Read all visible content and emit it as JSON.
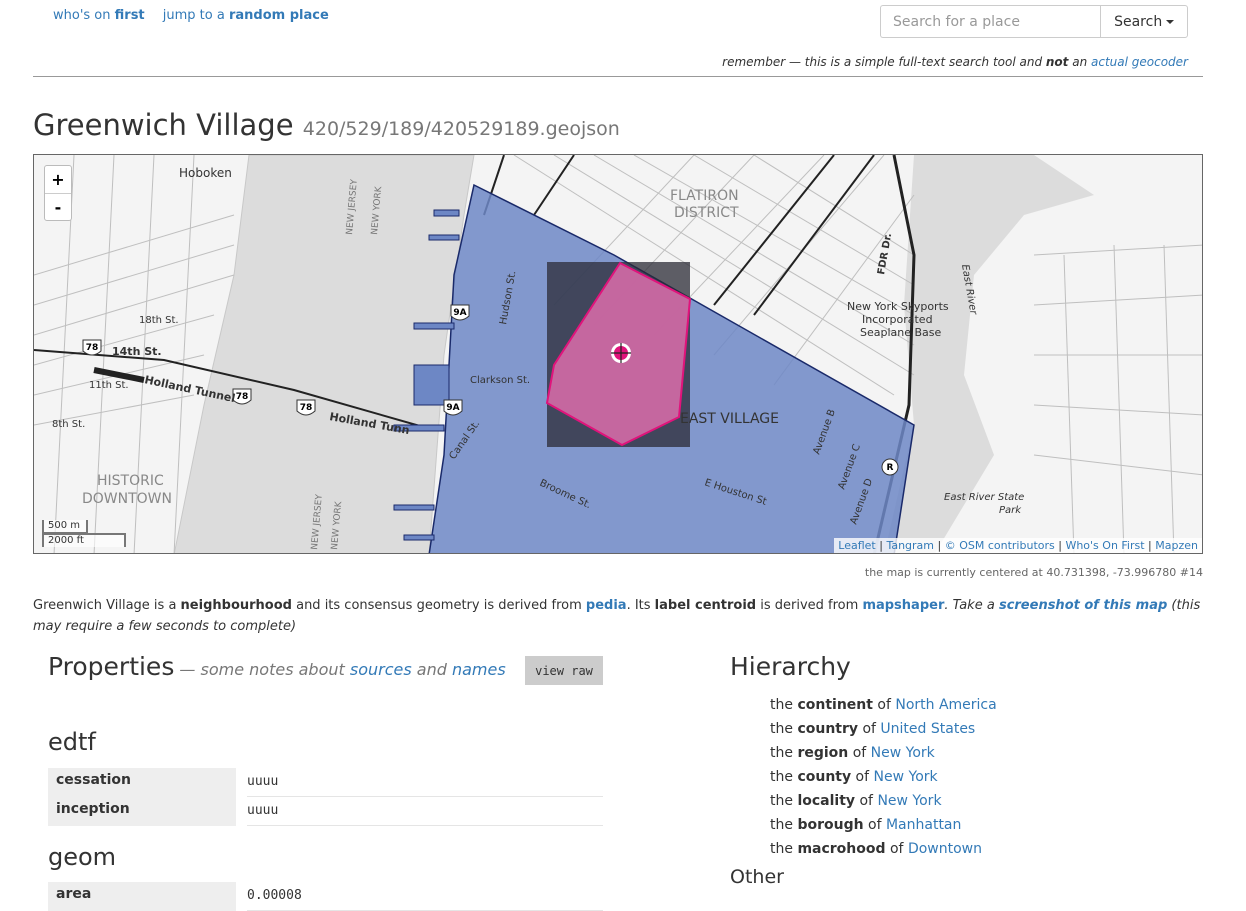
{
  "nav": {
    "whos_on_prefix": "who's on ",
    "whos_on_bold": "first",
    "jump_prefix": "jump to a ",
    "jump_bold": "random place"
  },
  "search": {
    "placeholder": "Search for a place",
    "button_label": "Search"
  },
  "remember": {
    "prefix": "remember — this is a simple full-text search tool and ",
    "not": "not",
    "middle": " an ",
    "link": "actual geocoder"
  },
  "place": {
    "name": "Greenwich Village",
    "path": "420/529/189/420529189.geojson"
  },
  "map": {
    "zoom_in": "+",
    "zoom_out": "-",
    "scale_m": "500 m",
    "scale_ft": "2000 ft",
    "attribution": [
      "Leaflet",
      "Tangram",
      "© OSM contributors",
      "Who's On First",
      "Mapzen"
    ],
    "labels": {
      "hoboken": "Hoboken",
      "flatiron": "FLATIRON",
      "district": "DISTRICT",
      "east_village": "EAST VILLAGE",
      "historic": "HISTORIC",
      "downtown": "DOWNTOWN",
      "skyports_1": "New York Skyports",
      "skyports_2": "Incorporated",
      "skyports_3": "Seaplane Base",
      "east_river_park_1": "East River State",
      "east_river_park_2": "Park",
      "holland_tunnel": "Holland Tunnel",
      "holland_tunn": "Holland Tunn",
      "fourteenth_st": "14th St.",
      "eleventh_st": "11th St.",
      "eighth_st": "8th St.",
      "eighteenth_st": "18th St.",
      "clarkson_st": "Clarkson St.",
      "hudson_st": "Hudson St.",
      "houston_st": "E Houston St",
      "broome_st": "Broome St.",
      "canal_st": "Canal St.",
      "new_jersey": "NEW JERSEY",
      "new_york": "NEW YORK",
      "east_river": "East River",
      "avenue_b": "Avenue B",
      "avenue_c": "Avenue C",
      "avenue_d": "Avenue D",
      "shield_78": "78",
      "shield_9a": "9A",
      "shield_r": "R",
      "fdr": "FDR Dr."
    },
    "colors": {
      "polygon_fill": "#6d87c5",
      "polygon_stroke": "#1a2a6a",
      "highlight_fill": "#d46aa6",
      "highlight_stroke": "#e0137b",
      "bbox_fill": "#2b2b35"
    }
  },
  "centered_text": "the map is currently centered at 40.731398, -73.996780 #14",
  "description": {
    "name": "Greenwich Village",
    "t1": " is a ",
    "placetype": "neighbourhood",
    "t2": " and its consensus geometry is derived from ",
    "geom_source": "pedia",
    "t3": ". Its ",
    "label_centroid": "label centroid",
    "t4": " is derived from ",
    "centroid_source": "mapshaper",
    "t5": ". Take a ",
    "screenshot_link": "screenshot of this map",
    "t6": " (this may require a few seconds to complete)"
  },
  "properties": {
    "title": "Properties",
    "notes_prefix": " — some notes about ",
    "sources": "sources",
    "and": " and ",
    "names": "names",
    "view_raw": "view raw",
    "sections": [
      {
        "title": "edtf",
        "rows": [
          {
            "key": "cessation",
            "value": "uuuu"
          },
          {
            "key": "inception",
            "value": "uuuu"
          }
        ]
      },
      {
        "title": "geom",
        "rows": [
          {
            "key": "area",
            "value": "0.00008"
          }
        ]
      }
    ]
  },
  "hierarchy": {
    "title": "Hierarchy",
    "items": [
      {
        "the": "the ",
        "type": "continent",
        "of": " of ",
        "name": "North America"
      },
      {
        "the": "the ",
        "type": "country",
        "of": " of ",
        "name": "United States"
      },
      {
        "the": "the ",
        "type": "region",
        "of": " of ",
        "name": "New York"
      },
      {
        "the": "the ",
        "type": "county",
        "of": " of ",
        "name": "New York"
      },
      {
        "the": "the ",
        "type": "locality",
        "of": " of ",
        "name": "New York"
      },
      {
        "the": "the ",
        "type": "borough",
        "of": " of ",
        "name": "Manhattan"
      },
      {
        "the": "the ",
        "type": "macrohood",
        "of": " of ",
        "name": "Downtown"
      }
    ],
    "other": "Other"
  }
}
